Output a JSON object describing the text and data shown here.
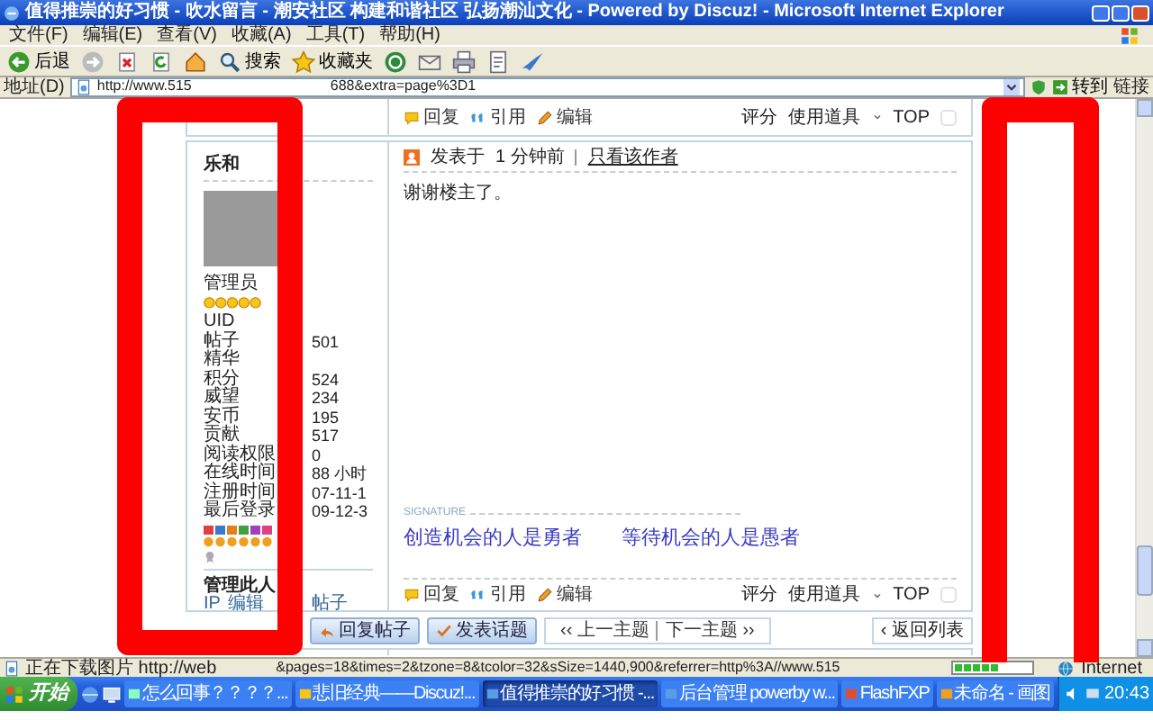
{
  "window": {
    "title": "值得推崇的好习惯 - 吹水留言 - 潮安社区 构建和谐社区 弘扬潮汕文化 - Powered by Discuz! - Microsoft Internet Explorer"
  },
  "menu": [
    "文件(F)",
    "编辑(E)",
    "查看(V)",
    "收藏(A)",
    "工具(T)",
    "帮助(H)"
  ],
  "toolbar": [
    {
      "kind": "back",
      "label": "后退"
    },
    {
      "kind": "forward"
    },
    {
      "kind": "stop"
    },
    {
      "kind": "refresh"
    },
    {
      "kind": "home"
    },
    {
      "kind": "search",
      "label": "搜索"
    },
    {
      "kind": "favorites",
      "label": "收藏夹"
    },
    {
      "kind": "media"
    },
    {
      "kind": "mail"
    },
    {
      "kind": "print"
    },
    {
      "kind": "edit"
    },
    {
      "kind": "messenger"
    }
  ],
  "address": {
    "label": "地址(D)",
    "url_start": "http://www.515",
    "url_end": "688&extra=page%3D1",
    "go": "转到",
    "links": "链接"
  },
  "previous_post": {
    "actions": [
      "回复",
      "引用",
      "编辑"
    ],
    "tools": [
      "评分",
      "使用道具",
      "TOP"
    ],
    "checked": false
  },
  "post": {
    "author": "乐和",
    "group": "管理员",
    "stats": [
      {
        "label": "UID"
      },
      {
        "label": "帖子",
        "value": "501"
      },
      {
        "label": "精华"
      },
      {
        "label": "积分",
        "value": "524"
      },
      {
        "label": "威望",
        "value": "234"
      },
      {
        "label": "安币",
        "value": "195"
      },
      {
        "label": "贡献",
        "value": "517"
      },
      {
        "label": "阅读权限",
        "value": "0"
      },
      {
        "label": "在线时间",
        "value": "88 小时"
      },
      {
        "label": "注册时间",
        "value": "07-11-1"
      },
      {
        "label": "最后登录",
        "value": "09-12-3"
      }
    ],
    "manage_label": "管理此人",
    "manage_links": [
      "IP",
      "编辑",
      "帖子"
    ],
    "posted": "发表于",
    "time": "1 分钟前",
    "author_only": "只看该作者",
    "message": "谢谢楼主了。",
    "signature_label": "SIGNATURE",
    "signature": [
      "创造机会的人是勇者",
      "等待机会的人是愚者"
    ],
    "actions": [
      "回复",
      "引用",
      "编辑"
    ],
    "tools": [
      "评分",
      "使用道具",
      "TOP"
    ],
    "checked": false
  },
  "buttons": [
    "回复帖子",
    "发表话题"
  ],
  "thread_nav": [
    "‹‹ 上一主题",
    "下一主题 ››"
  ],
  "back_to_list": "‹ 返回列表",
  "status_bar": {
    "text_start": "正在下载图片 http://web",
    "text_end": "&pages=18&times=2&tzone=8&tcolor=32&sSize=1440,900&referrer=http%3A//www.515",
    "level": 0.6,
    "zone": "Internet"
  },
  "taskbar": {
    "start": "开始",
    "tasks": [
      {
        "label": "怎么回事？？？？...",
        "selected": false
      },
      {
        "label": "悲旧经典——Discuz!...",
        "selected": false
      },
      {
        "label": "值得推崇的好习惯 -...",
        "selected": true
      },
      {
        "label": "后台管理 powerby w...",
        "selected": false
      },
      {
        "label": "FlashFXP",
        "selected": false
      },
      {
        "label": "未命名 - 画图",
        "selected": false
      }
    ],
    "clock": "20:43"
  }
}
